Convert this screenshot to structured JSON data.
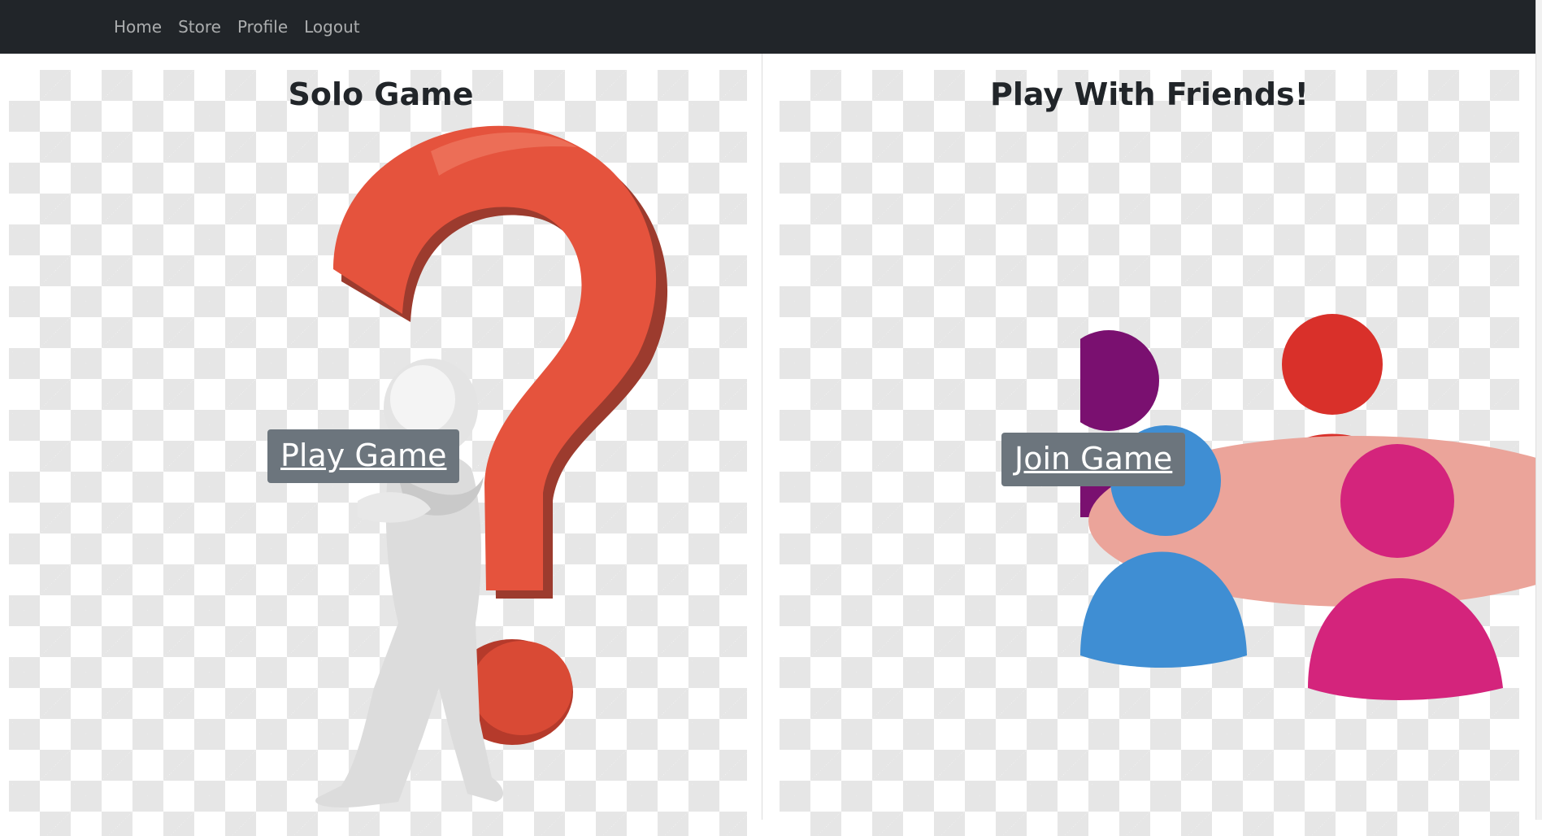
{
  "navbar": {
    "links": [
      {
        "label": "Home"
      },
      {
        "label": "Store"
      },
      {
        "label": "Profile"
      },
      {
        "label": "Logout"
      }
    ]
  },
  "solo": {
    "title": "Solo Game",
    "button_label": "Play Game",
    "image_icon": "question-mark-thinker-icon",
    "accent_color": "#e5533d"
  },
  "friends": {
    "title": "Play With Friends!",
    "button_label": "Join Game",
    "image_icon": "people-around-table-icon",
    "person_colors": [
      "#7a1070",
      "#d9302a",
      "#3f8ed3",
      "#d4247c"
    ],
    "table_color": "#eba49a"
  },
  "theme": {
    "navbar_bg": "#212529",
    "button_bg": "#6c757d"
  }
}
